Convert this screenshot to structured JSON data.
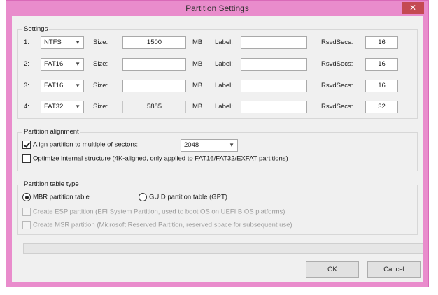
{
  "window": {
    "title": "Partition Settings",
    "close_glyph": "✕"
  },
  "settings": {
    "legend": "Settings",
    "size_label": "Size:",
    "unit": "MB",
    "label_label": "Label:",
    "rsvd_label": "RsvdSecs:",
    "rows": [
      {
        "index": "1:",
        "fs": "NTFS",
        "size": "1500",
        "size_enabled": true,
        "label": "",
        "rsvd": "16"
      },
      {
        "index": "2:",
        "fs": "FAT16",
        "size": "",
        "size_enabled": true,
        "label": "",
        "rsvd": "16"
      },
      {
        "index": "3:",
        "fs": "FAT16",
        "size": "",
        "size_enabled": true,
        "label": "",
        "rsvd": "16"
      },
      {
        "index": "4:",
        "fs": "FAT32",
        "size": "5885",
        "size_enabled": false,
        "label": "",
        "rsvd": "32"
      }
    ]
  },
  "alignment": {
    "legend": "Partition alignment",
    "align_label": "Align partition to multiple of sectors:",
    "align_checked": true,
    "sectors_value": "2048",
    "optimize_label": "Optimize internal structure (4K-aligned, only applied to FAT16/FAT32/EXFAT partitions)",
    "optimize_checked": false
  },
  "table_type": {
    "legend": "Partition table type",
    "mbr_label": "MBR partition table",
    "gpt_label": "GUID partition table (GPT)",
    "selected": "mbr",
    "esp_label": "Create ESP partition (EFI System Partition, used to boot OS on UEFI BIOS platforms)",
    "msr_label": "Create MSR partition (Microsoft Reserved Partition, reserved space for subsequent use)"
  },
  "buttons": {
    "ok": "OK",
    "cancel": "Cancel"
  },
  "colors": {
    "frame": "#e98ccc",
    "close": "#c44a52",
    "client": "#f0f0f0"
  },
  "icons": {
    "dropdown": "chevron-down-icon",
    "close": "close-icon"
  }
}
